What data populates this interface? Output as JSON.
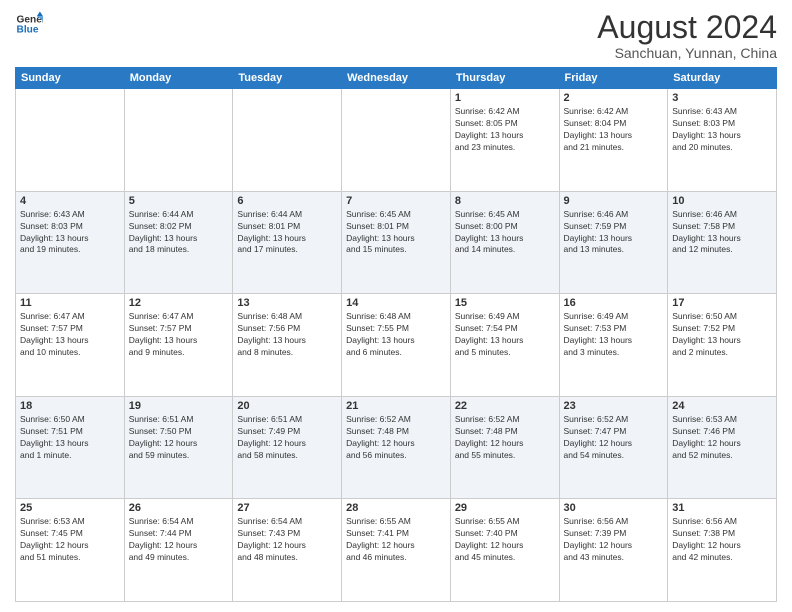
{
  "logo": {
    "line1": "General",
    "line2": "Blue"
  },
  "title": "August 2024",
  "subtitle": "Sanchuan, Yunnan, China",
  "weekdays": [
    "Sunday",
    "Monday",
    "Tuesday",
    "Wednesday",
    "Thursday",
    "Friday",
    "Saturday"
  ],
  "weeks": [
    {
      "days": [
        {
          "num": "",
          "info": ""
        },
        {
          "num": "",
          "info": ""
        },
        {
          "num": "",
          "info": ""
        },
        {
          "num": "",
          "info": ""
        },
        {
          "num": "1",
          "info": "Sunrise: 6:42 AM\nSunset: 8:05 PM\nDaylight: 13 hours\nand 23 minutes."
        },
        {
          "num": "2",
          "info": "Sunrise: 6:42 AM\nSunset: 8:04 PM\nDaylight: 13 hours\nand 21 minutes."
        },
        {
          "num": "3",
          "info": "Sunrise: 6:43 AM\nSunset: 8:03 PM\nDaylight: 13 hours\nand 20 minutes."
        }
      ]
    },
    {
      "days": [
        {
          "num": "4",
          "info": "Sunrise: 6:43 AM\nSunset: 8:03 PM\nDaylight: 13 hours\nand 19 minutes."
        },
        {
          "num": "5",
          "info": "Sunrise: 6:44 AM\nSunset: 8:02 PM\nDaylight: 13 hours\nand 18 minutes."
        },
        {
          "num": "6",
          "info": "Sunrise: 6:44 AM\nSunset: 8:01 PM\nDaylight: 13 hours\nand 17 minutes."
        },
        {
          "num": "7",
          "info": "Sunrise: 6:45 AM\nSunset: 8:01 PM\nDaylight: 13 hours\nand 15 minutes."
        },
        {
          "num": "8",
          "info": "Sunrise: 6:45 AM\nSunset: 8:00 PM\nDaylight: 13 hours\nand 14 minutes."
        },
        {
          "num": "9",
          "info": "Sunrise: 6:46 AM\nSunset: 7:59 PM\nDaylight: 13 hours\nand 13 minutes."
        },
        {
          "num": "10",
          "info": "Sunrise: 6:46 AM\nSunset: 7:58 PM\nDaylight: 13 hours\nand 12 minutes."
        }
      ]
    },
    {
      "days": [
        {
          "num": "11",
          "info": "Sunrise: 6:47 AM\nSunset: 7:57 PM\nDaylight: 13 hours\nand 10 minutes."
        },
        {
          "num": "12",
          "info": "Sunrise: 6:47 AM\nSunset: 7:57 PM\nDaylight: 13 hours\nand 9 minutes."
        },
        {
          "num": "13",
          "info": "Sunrise: 6:48 AM\nSunset: 7:56 PM\nDaylight: 13 hours\nand 8 minutes."
        },
        {
          "num": "14",
          "info": "Sunrise: 6:48 AM\nSunset: 7:55 PM\nDaylight: 13 hours\nand 6 minutes."
        },
        {
          "num": "15",
          "info": "Sunrise: 6:49 AM\nSunset: 7:54 PM\nDaylight: 13 hours\nand 5 minutes."
        },
        {
          "num": "16",
          "info": "Sunrise: 6:49 AM\nSunset: 7:53 PM\nDaylight: 13 hours\nand 3 minutes."
        },
        {
          "num": "17",
          "info": "Sunrise: 6:50 AM\nSunset: 7:52 PM\nDaylight: 13 hours\nand 2 minutes."
        }
      ]
    },
    {
      "days": [
        {
          "num": "18",
          "info": "Sunrise: 6:50 AM\nSunset: 7:51 PM\nDaylight: 13 hours\nand 1 minute."
        },
        {
          "num": "19",
          "info": "Sunrise: 6:51 AM\nSunset: 7:50 PM\nDaylight: 12 hours\nand 59 minutes."
        },
        {
          "num": "20",
          "info": "Sunrise: 6:51 AM\nSunset: 7:49 PM\nDaylight: 12 hours\nand 58 minutes."
        },
        {
          "num": "21",
          "info": "Sunrise: 6:52 AM\nSunset: 7:48 PM\nDaylight: 12 hours\nand 56 minutes."
        },
        {
          "num": "22",
          "info": "Sunrise: 6:52 AM\nSunset: 7:48 PM\nDaylight: 12 hours\nand 55 minutes."
        },
        {
          "num": "23",
          "info": "Sunrise: 6:52 AM\nSunset: 7:47 PM\nDaylight: 12 hours\nand 54 minutes."
        },
        {
          "num": "24",
          "info": "Sunrise: 6:53 AM\nSunset: 7:46 PM\nDaylight: 12 hours\nand 52 minutes."
        }
      ]
    },
    {
      "days": [
        {
          "num": "25",
          "info": "Sunrise: 6:53 AM\nSunset: 7:45 PM\nDaylight: 12 hours\nand 51 minutes."
        },
        {
          "num": "26",
          "info": "Sunrise: 6:54 AM\nSunset: 7:44 PM\nDaylight: 12 hours\nand 49 minutes."
        },
        {
          "num": "27",
          "info": "Sunrise: 6:54 AM\nSunset: 7:43 PM\nDaylight: 12 hours\nand 48 minutes."
        },
        {
          "num": "28",
          "info": "Sunrise: 6:55 AM\nSunset: 7:41 PM\nDaylight: 12 hours\nand 46 minutes."
        },
        {
          "num": "29",
          "info": "Sunrise: 6:55 AM\nSunset: 7:40 PM\nDaylight: 12 hours\nand 45 minutes."
        },
        {
          "num": "30",
          "info": "Sunrise: 6:56 AM\nSunset: 7:39 PM\nDaylight: 12 hours\nand 43 minutes."
        },
        {
          "num": "31",
          "info": "Sunrise: 6:56 AM\nSunset: 7:38 PM\nDaylight: 12 hours\nand 42 minutes."
        }
      ]
    }
  ]
}
